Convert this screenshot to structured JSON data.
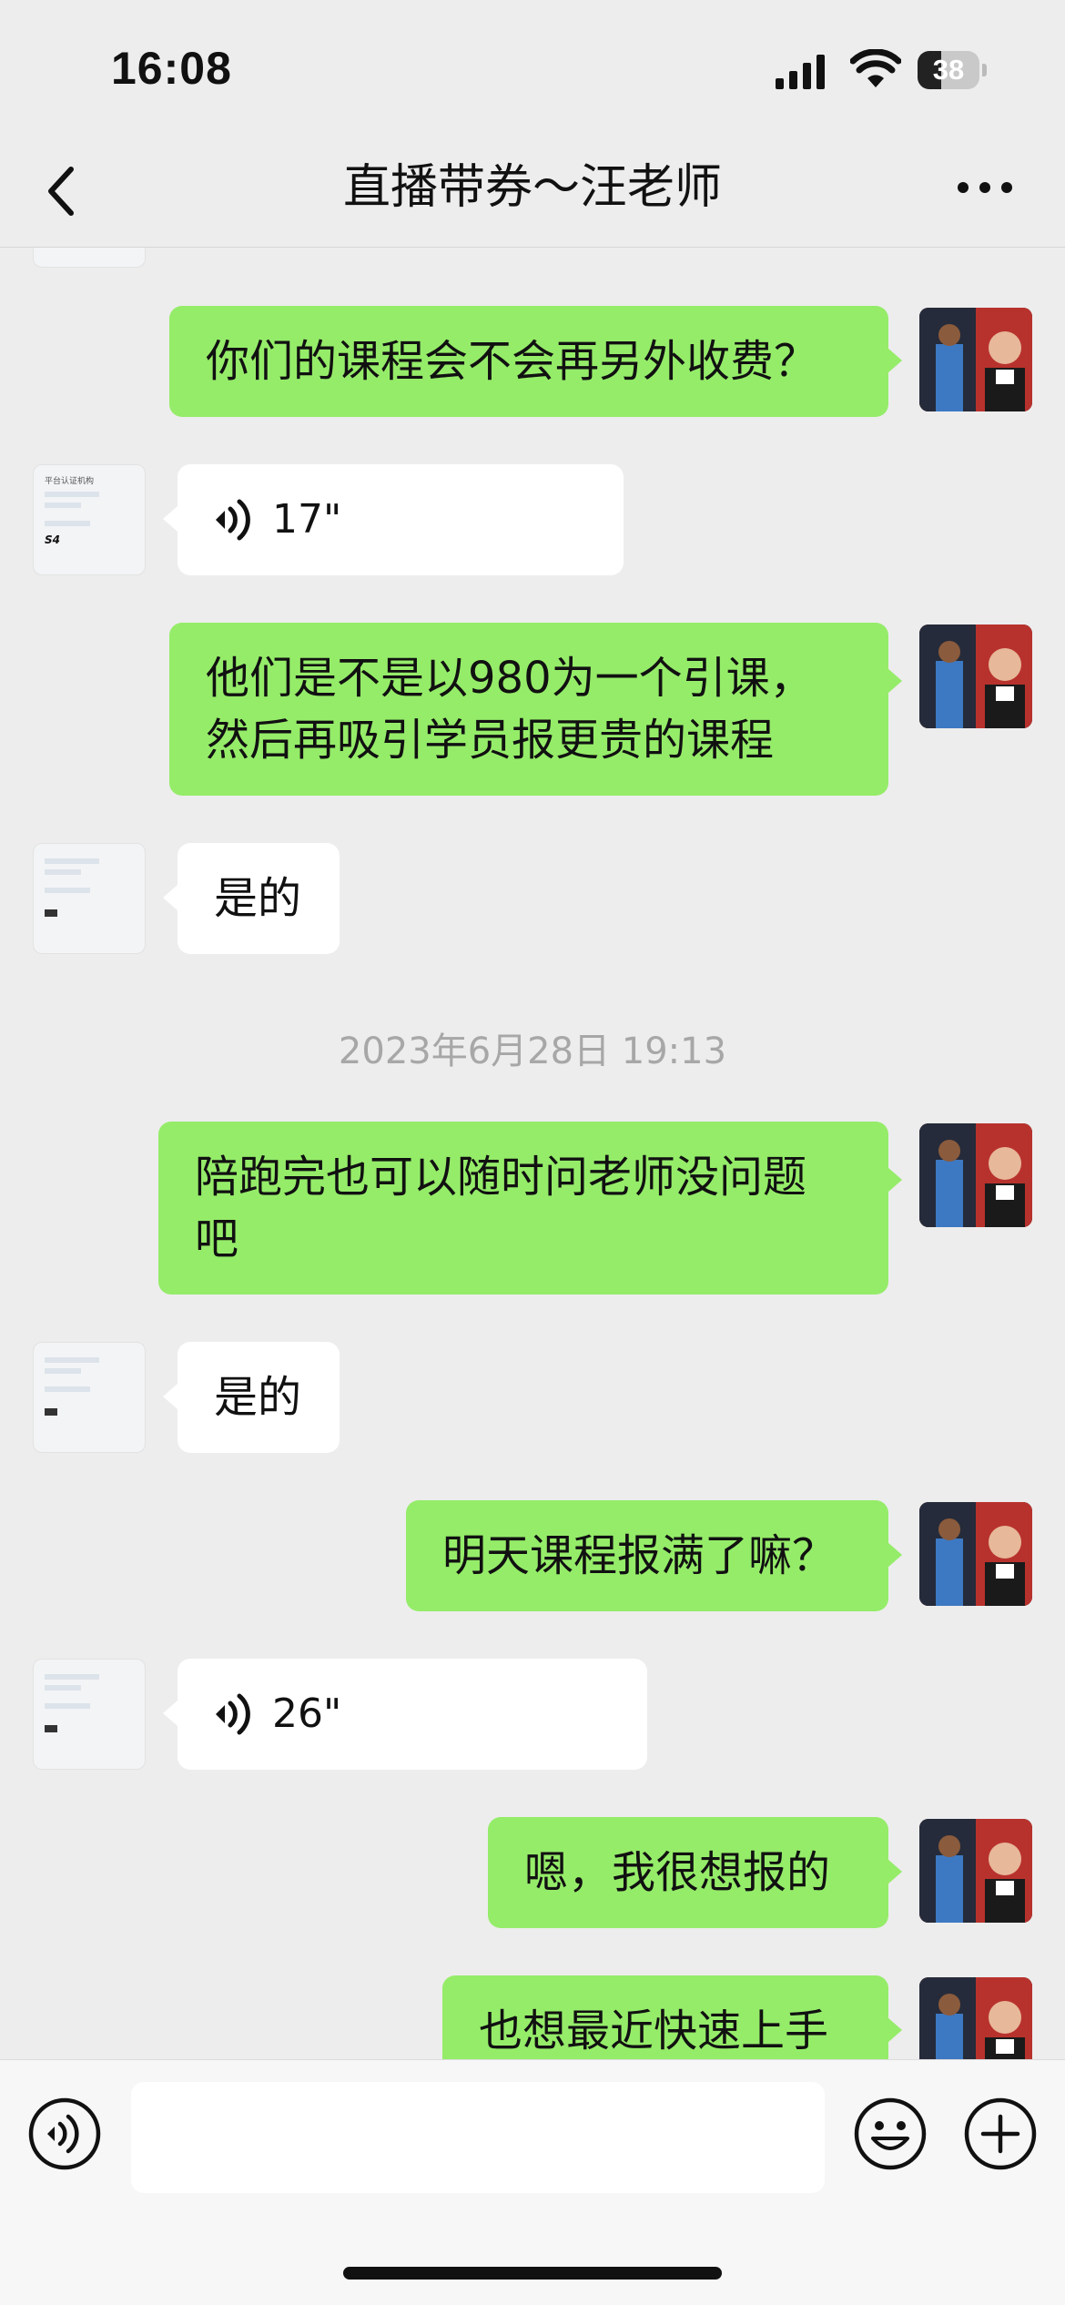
{
  "status_bar": {
    "time": "16:08",
    "battery": "38",
    "battery_level": 0.38
  },
  "header": {
    "title": "直播带券～汪老师",
    "back_icon": "chevron-left-icon",
    "more_icon": "more-dots-icon"
  },
  "avatar_card": {
    "title": "平台认证机构",
    "code": "S4"
  },
  "messages": [
    {
      "side": "out",
      "type": "text",
      "text": "你们的课程会不会再另外收费？"
    },
    {
      "side": "in",
      "type": "voice",
      "duration": "17\""
    },
    {
      "side": "out",
      "type": "text",
      "lines": [
        "他们是不是以980为一个引课，",
        "然后再吸引学员报更贵的课程"
      ]
    },
    {
      "side": "in",
      "type": "text",
      "text": "是的"
    },
    {
      "type": "timestamp",
      "text": "2023年6月28日 19:13"
    },
    {
      "side": "out",
      "type": "text",
      "lines": [
        "陪跑完也可以随时问老师没问题",
        "吧"
      ]
    },
    {
      "side": "in",
      "type": "text",
      "text": "是的"
    },
    {
      "side": "out",
      "type": "text",
      "text": "明天课程报满了嘛？"
    },
    {
      "side": "in",
      "type": "voice",
      "duration": "26\""
    },
    {
      "side": "out",
      "type": "text",
      "text": "嗯，我很想报的"
    },
    {
      "side": "out",
      "type": "text",
      "text": "也想最近快速上手"
    }
  ],
  "input_bar": {
    "voice_icon": "voice-input-icon",
    "emoji_icon": "emoji-smile-icon",
    "plus_icon": "plus-circle-icon"
  },
  "colors": {
    "outgoing_bubble": "#95ec69",
    "incoming_bubble": "#ffffff",
    "background": "#ededed"
  }
}
